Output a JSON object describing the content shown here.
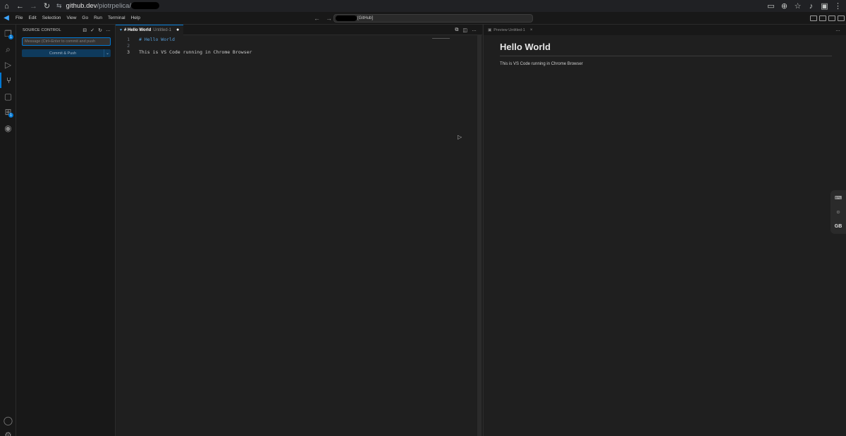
{
  "browser": {
    "url_host": "github.dev",
    "url_path": "/piotrpelica/",
    "icons": [
      "home-icon",
      "back-arrow-icon",
      "forward-arrow-icon",
      "reload-icon",
      "site-settings-icon",
      "cast-icon",
      "zoom-icon",
      "bookmark-star-icon",
      "mic-icon",
      "extension-icon",
      "kebab-menu-icon"
    ]
  },
  "titlebar": {
    "menu": [
      "File",
      "Edit",
      "Selection",
      "View",
      "Go",
      "Run",
      "Terminal",
      "Help"
    ],
    "command_center_suffix": "[GitHub]"
  },
  "activity_bar": {
    "items": [
      "explorer-icon",
      "search-icon",
      "run-debug-icon",
      "source-control-icon",
      "remote-explorer-icon",
      "extensions-icon",
      "github-icon"
    ],
    "explorer_badge": "1",
    "extensions_badge": "1",
    "bottom": [
      "account-icon",
      "settings-gear-icon"
    ]
  },
  "sidebar": {
    "title": "SOURCE CONTROL",
    "commit_placeholder": "Message (Ctrl+Enter to commit and push",
    "commit_button": "Commit & Push"
  },
  "editor": {
    "tab_name": "# Hello World",
    "tab_desc": "Untitled-1",
    "tab_dirty": "●",
    "lines": [
      {
        "n": "1",
        "text": "# Hello World"
      },
      {
        "n": "2",
        "text": ""
      },
      {
        "n": "3",
        "text": "This is VS Code running in Chrome Browser"
      }
    ]
  },
  "preview": {
    "tab_label": "Preview Untitled-1",
    "tab_close": "×",
    "heading": "Hello World",
    "paragraph": "This is VS Code running in Chrome Browser"
  },
  "floating": {
    "gb_label": "GB"
  }
}
